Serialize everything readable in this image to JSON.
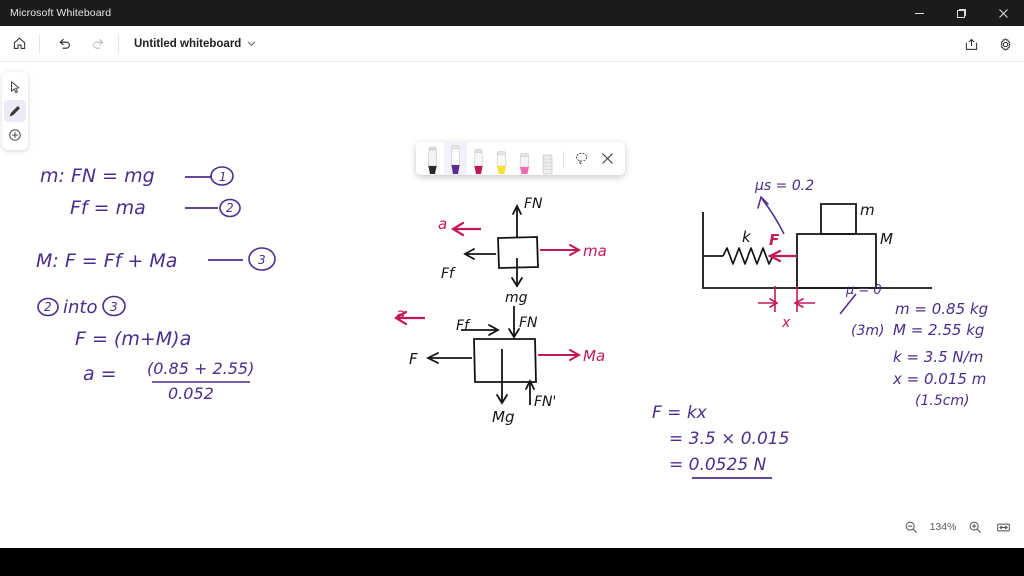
{
  "window": {
    "app_title": "Microsoft Whiteboard",
    "controls": [
      {
        "name": "minimize-button",
        "icon": "minimize-icon",
        "label": "Minimize"
      },
      {
        "name": "maximize-button",
        "icon": "maximize-icon",
        "label": "Restore"
      },
      {
        "name": "close-button",
        "icon": "close-icon",
        "label": "Close"
      }
    ]
  },
  "toolbar": {
    "home_label": "Home",
    "undo_label": "Undo",
    "redo_label": "Redo",
    "document_title": "Untitled whiteboard",
    "title_chevron": "chevron-down-icon",
    "share_label": "Share",
    "settings_label": "Settings"
  },
  "toolrail": {
    "items": [
      {
        "name": "select-tool",
        "icon": "cursor-arrow-icon",
        "label": "Select",
        "active": false
      },
      {
        "name": "pen-tool",
        "icon": "pen-icon",
        "label": "Inking",
        "active": true
      },
      {
        "name": "insert-tool",
        "icon": "plus-circle-icon",
        "label": "Create",
        "active": false
      }
    ]
  },
  "pen_toolbar": {
    "pens": [
      {
        "name": "pen-black",
        "label": "Pen black",
        "color": "#2b2b2b",
        "body": "#f2f2f2",
        "selected": false
      },
      {
        "name": "pen-purple",
        "label": "Pen purple",
        "color": "#5b2d8e",
        "body": "#ffffff",
        "selected": true
      },
      {
        "name": "pen-magenta",
        "label": "Pen magenta",
        "color": "#c2185b",
        "body": "#f7f7f7",
        "selected": false
      },
      {
        "name": "highlighter-yellow",
        "label": "Highlighter yellow",
        "color": "#f2e33c",
        "body": "#fafafa",
        "selected": false
      },
      {
        "name": "highlighter-pink",
        "label": "Highlighter pink",
        "color": "#f06ab0",
        "body": "#f5f5f5",
        "selected": false
      },
      {
        "name": "eraser",
        "label": "Eraser",
        "color": "#d9d9d9",
        "body": "#ededed",
        "selected": false
      }
    ],
    "lasso_label": "Lasso select",
    "close_label": "Close ink toolbar"
  },
  "zoom_bar": {
    "zoom_out_label": "Zoom out",
    "zoom_level": "134%",
    "zoom_in_label": "Zoom in",
    "fit_label": "Fit to screen"
  },
  "ink_colors": {
    "purple": "#4b2d8c",
    "black": "#141414",
    "magenta": "#c2185b"
  },
  "ink": {
    "equations_block": {
      "line1": "m:  FN = mg",
      "line1_label": "1",
      "line2": "Ff = ma",
      "line2_label": "2",
      "line3": "M:  F = Ff + Ma",
      "line3_label": "3",
      "line4_ref_a": "2",
      "line4_text": "into",
      "line4_ref_b": "3",
      "line5": "F = (m+M)a",
      "line6_lhs": "a =",
      "line6_num": "(0.85 + 2.55)",
      "line6_den": "0.052"
    },
    "fbd_small_block": {
      "accel": "a",
      "normal": "FN",
      "applied": "ma",
      "friction": "Ff",
      "weight": "mg"
    },
    "fbd_large_block": {
      "accel": "a",
      "friction": "Ff",
      "normal_down": "FN",
      "applied_left": "F",
      "applied_right": "Ma",
      "weight": "Mg",
      "normal_up": "FN'"
    },
    "setup_diagram": {
      "mu_static": "μs = 0.2",
      "spring": "k",
      "force": "F",
      "small_mass": "m",
      "large_mass": "M",
      "mu_ground": "μ = 0",
      "displacement": "x"
    },
    "given_values": {
      "mass_small": "m = 0.85 kg",
      "mass_note": "(3m)",
      "mass_large": "M = 2.55 kg",
      "spring_constant": "k = 3.5 N/m",
      "displacement": "x = 0.015 m",
      "displacement_alt": "(1.5cm)"
    },
    "force_calc": {
      "line1": "F = kx",
      "line2": "= 3.5 × 0.015",
      "line3": "= 0.0525 N"
    }
  }
}
